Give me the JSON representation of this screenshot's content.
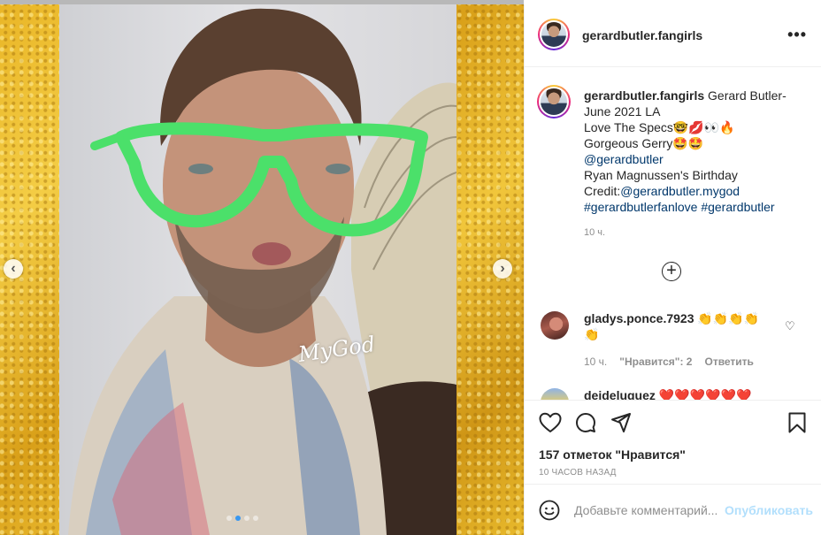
{
  "post": {
    "watermark": "MyGod",
    "carousel": {
      "slide_count": 4,
      "active_index": 1
    }
  },
  "header": {
    "username": "gerardbutler.fangirls",
    "more_label": "•••"
  },
  "caption": {
    "username": "gerardbutler.fangirls",
    "line1": "Gerard Butler-",
    "line2": "June 2021 LA",
    "line3": "Love The Specs🤓💋👀🔥",
    "line4": "Gorgeous Gerry🤩🤩",
    "mention1": "@gerardbutler",
    "line5": "Ryan Magnussen's Birthday",
    "credit_prefix": "Credit:",
    "credit_mention": "@gerardbutler.mygod",
    "hashtag1": "#gerardbutlerfanlove",
    "hashtag2": "#gerardbutler",
    "time": "10 ч."
  },
  "load_more": {
    "label": "+"
  },
  "comments": [
    {
      "username": "gladys.ponce.7923",
      "text": "👏👏👏👏👏",
      "time": "10 ч.",
      "likes": "\"Нравится\": 2",
      "reply_label": "Ответить"
    },
    {
      "username": "dejdeluguez",
      "text": "❤️❤️❤️❤️❤️❤️"
    }
  ],
  "stats": {
    "likes": "157 отметок \"Нравится\"",
    "time_ago": "10 ЧАСОВ НАЗАД"
  },
  "comment_form": {
    "placeholder": "Добавьте комментарий...",
    "publish_label": "Опубликовать"
  },
  "colors": {
    "link": "#00376b",
    "publish_disabled": "#b2dffc",
    "carousel_active": "#3897f0",
    "glasses": "#4be06a"
  },
  "icons": [
    "heart-icon",
    "comment-icon",
    "share-icon",
    "bookmark-icon",
    "emoji-icon",
    "more-icon",
    "plus-circle-icon",
    "chevron-left-icon",
    "chevron-right-icon"
  ]
}
